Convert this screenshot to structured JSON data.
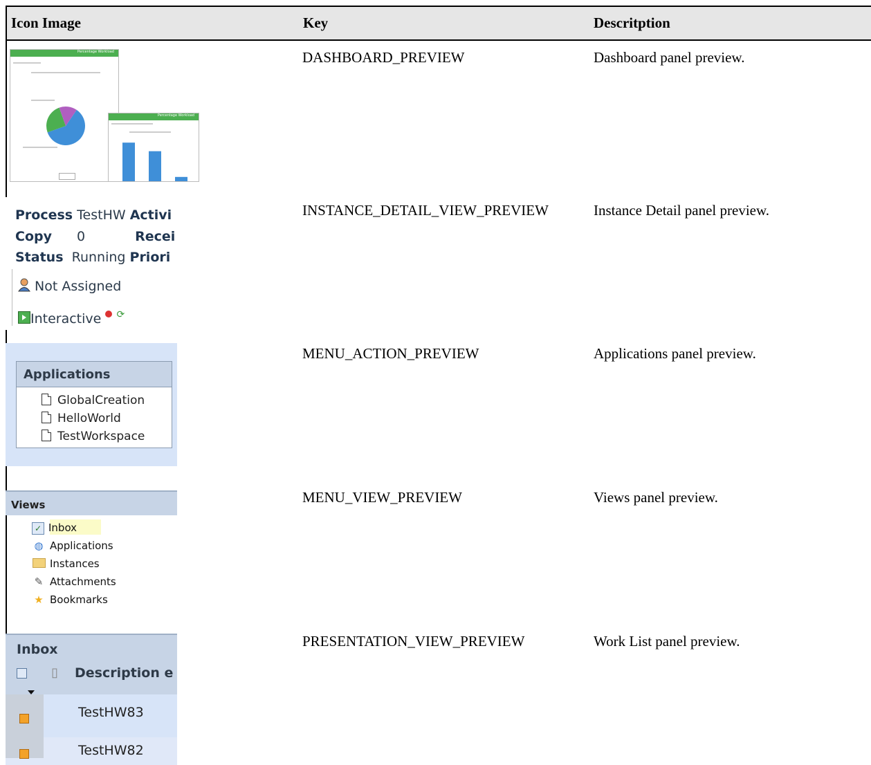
{
  "table": {
    "headers": [
      "Icon Image",
      "Key",
      "Descritption"
    ],
    "rows": [
      {
        "key": "DASHBOARD_PREVIEW",
        "description": "Dashboard panel preview."
      },
      {
        "key": "INSTANCE_DETAIL_VIEW_PREVIEW",
        "description": "Instance Detail panel preview."
      },
      {
        "key": "MENU_ACTION_PREVIEW",
        "description": "Applications panel preview."
      },
      {
        "key": "MENU_VIEW_PREVIEW",
        "description": "Views panel preview."
      },
      {
        "key": "PRESENTATION_VIEW_PREVIEW",
        "description": "Work List panel preview."
      }
    ]
  },
  "dashboard_preview": {
    "panel_title_1": "Percentage Workload",
    "panel_title_2": "Percentage Workload",
    "chart_data": {
      "type": "pie",
      "slices": [
        {
          "label": "",
          "value": 60,
          "color": "#3f8fd8"
        },
        {
          "label": "",
          "value": 25,
          "color": "#4caf50"
        },
        {
          "label": "",
          "value": 15,
          "color": "#b05fc0"
        }
      ],
      "bar_values": [
        90,
        70,
        10
      ],
      "bar_color": "#3f8fd8"
    }
  },
  "instance_preview": {
    "rows": [
      {
        "label": "Process",
        "value": "TestHW",
        "label2": "Activi"
      },
      {
        "label": "Copy",
        "value": "0",
        "label2": "Recei"
      },
      {
        "label": "Status",
        "value": "Running",
        "label2": "Priori"
      }
    ],
    "assignee": "Not Assigned",
    "mode": "Interactive"
  },
  "applications_preview": {
    "title": "Applications",
    "items": [
      "GlobalCreation",
      "HelloWorld",
      "TestWorkspace"
    ]
  },
  "views_preview": {
    "title": "Views",
    "items": [
      {
        "label": "Inbox",
        "icon": "checkbox-icon"
      },
      {
        "label": "Applications",
        "icon": "globe-icon"
      },
      {
        "label": "Instances",
        "icon": "folder-icon"
      },
      {
        "label": "Attachments",
        "icon": "paperclip-icon"
      },
      {
        "label": "Bookmarks",
        "icon": "star-icon"
      }
    ]
  },
  "inbox_preview": {
    "title": "Inbox",
    "column_label": "Description",
    "column_partial": "e",
    "rows": [
      "TestHW83",
      "TestHW82"
    ]
  }
}
